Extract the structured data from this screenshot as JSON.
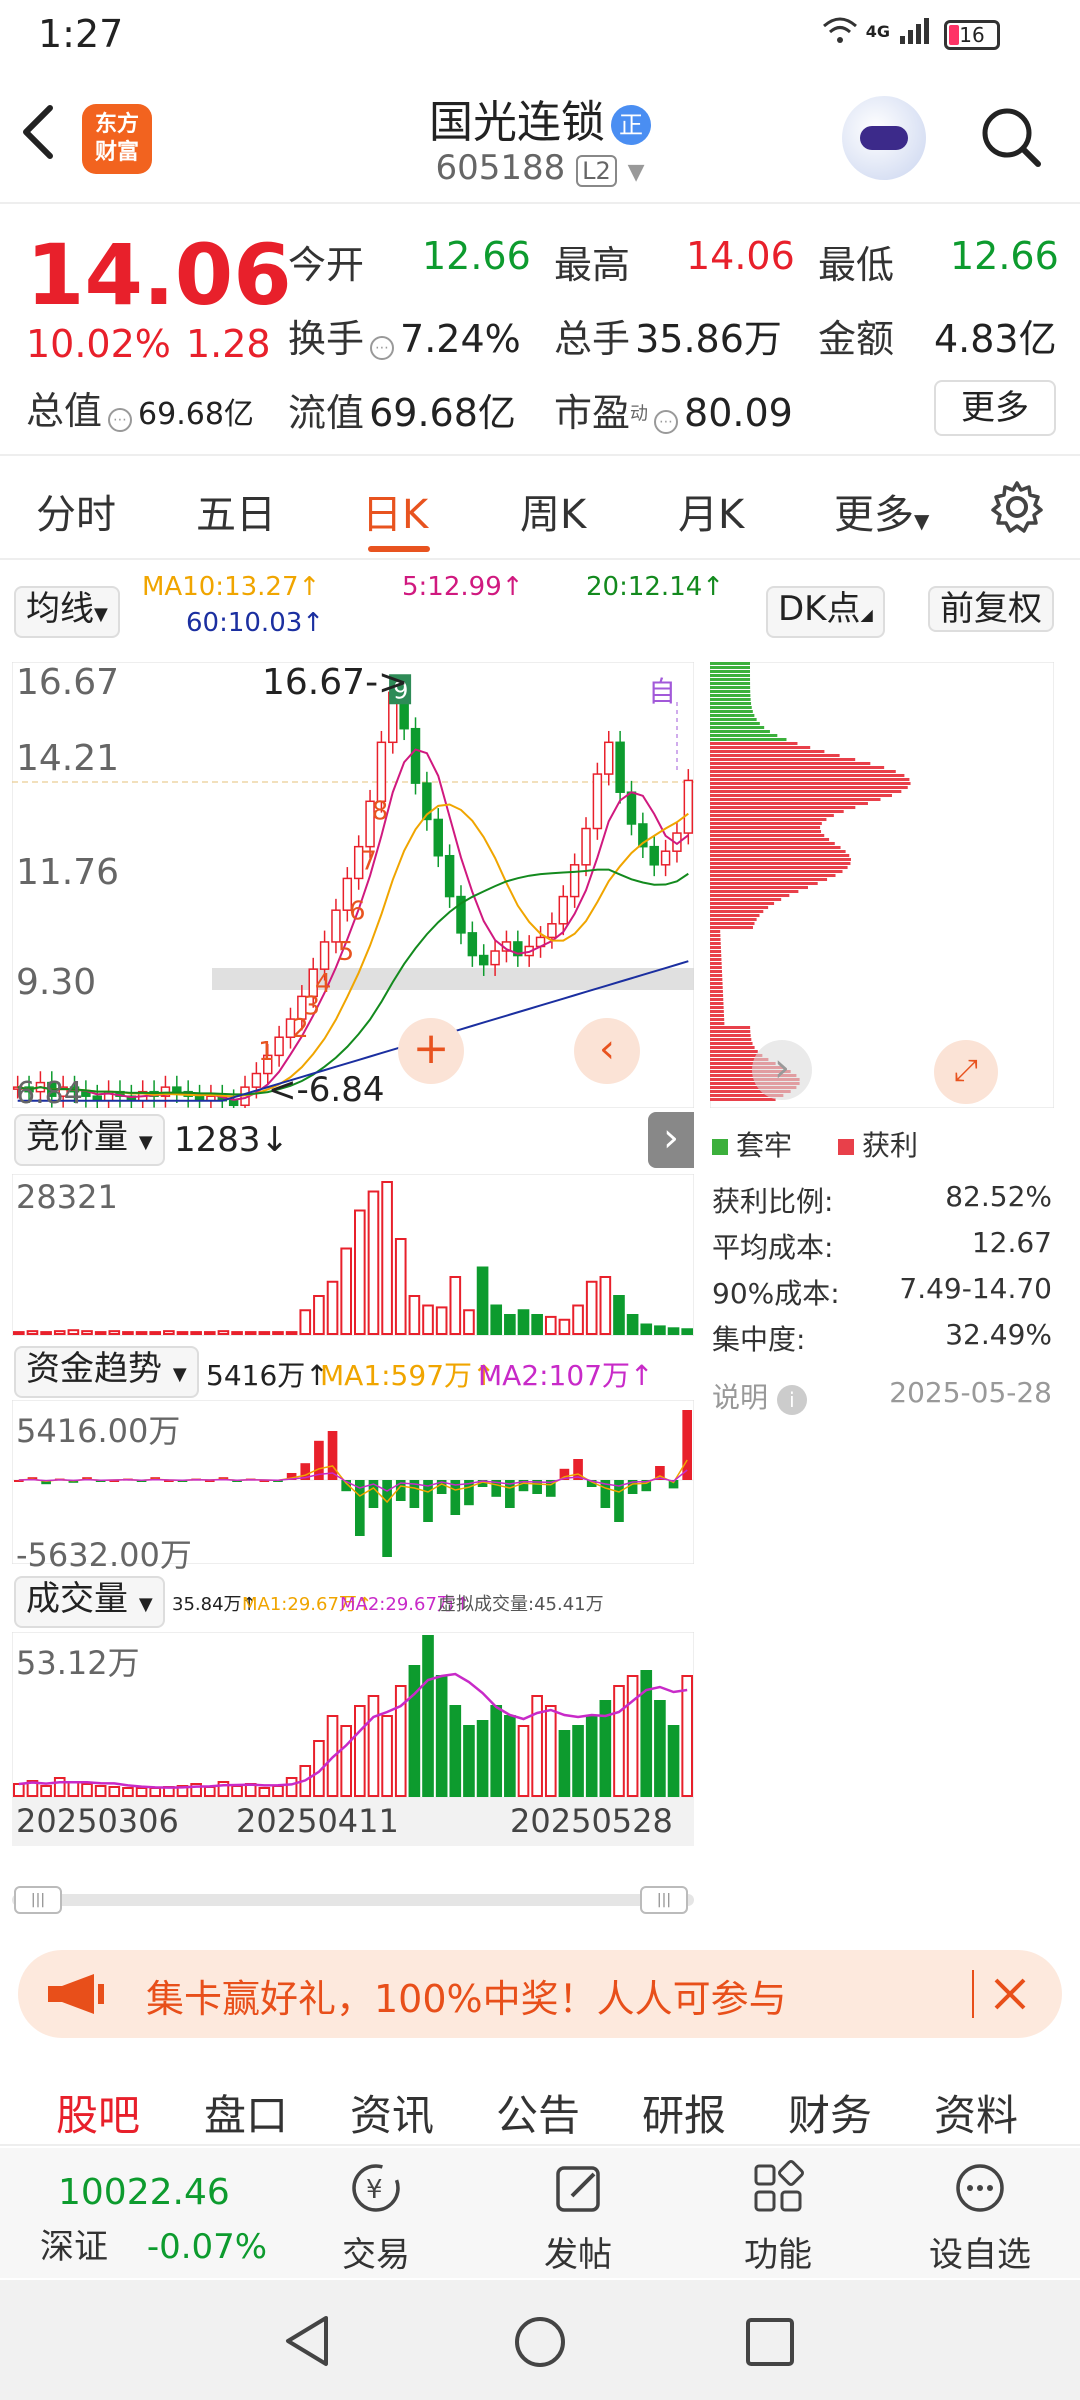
{
  "status": {
    "time": "1:27",
    "network": "4G",
    "battery": "16"
  },
  "header": {
    "back_icon": "back-arrow-icon",
    "logo_line1": "东方",
    "logo_line2": "财富",
    "stock_name": "国光连锁",
    "badge": "正",
    "stock_code": "605188",
    "level": "L2"
  },
  "quote": {
    "price": "14.06",
    "pct": "10.02%",
    "change": "1.28",
    "open_label": "今开",
    "open": "12.66",
    "high_label": "最高",
    "high": "14.06",
    "low_label": "最低",
    "low": "12.66",
    "turnover_label": "换手",
    "turnover": "7.24%",
    "volume_label": "总手",
    "volume": "35.86万",
    "amount_label": "金额",
    "amount": "4.83亿",
    "mktcap_label": "总值",
    "mktcap": "69.68亿",
    "float_label": "流值",
    "float": "69.68亿",
    "pe_label": "市盈",
    "pe_sup": "动",
    "pe": "80.09",
    "more": "更多"
  },
  "tabs": [
    "分时",
    "五日",
    "日K",
    "周K",
    "月K",
    "更多"
  ],
  "active_tab": "日K",
  "chart": {
    "ma_button": "均线",
    "ma10": "MA10:13.27↑",
    "ma5": "5:12.99↑",
    "ma20": "20:12.14↑",
    "ma60": "60:10.03↑",
    "dk_button": "DK点",
    "adj_button": "前复权",
    "y_labels": [
      "16.67",
      "14.21",
      "11.76",
      "9.30",
      "6.84"
    ],
    "high_marker": "16.67",
    "low_marker": "6.84",
    "self_tag": "自",
    "signal_numbers": [
      "1",
      "2",
      "3",
      "4",
      "5",
      "6",
      "7",
      "8",
      "9"
    ],
    "colors": {
      "up": "#e8202b",
      "down": "#0d9b2e",
      "ma5": "#d0197f",
      "ma10": "#f0a500",
      "ma20": "#138a1e",
      "ma60": "#1b2fa0"
    }
  },
  "auction": {
    "label": "竞价量",
    "value": "1283↓",
    "axis_max": "28321"
  },
  "fund_flow": {
    "label": "资金趋势",
    "value": "5416万↑",
    "ma1": "MA1:597万↑",
    "ma2": "MA2:107万↑",
    "axis_max": "5416.00万",
    "axis_min": "-5632.00万"
  },
  "volume": {
    "label": "成交量",
    "value": "35.84万↑",
    "ma1": "MA1:29.67万↑",
    "ma2": "MA2:29.67万↑",
    "virtual": "虚拟成交量:45.41万",
    "axis_max": "53.12万"
  },
  "dates": [
    "20250306",
    "20250411",
    "20250528"
  ],
  "chip_dist": {
    "legend_trapped": "套牢",
    "legend_profit": "获利",
    "rows": [
      {
        "label": "获利比例:",
        "value": "82.52%"
      },
      {
        "label": "平均成本:",
        "value": "12.67"
      },
      {
        "label": "90%成本:",
        "value": "7.49-14.70"
      },
      {
        "label": "集中度:",
        "value": "32.49%"
      }
    ],
    "note_label": "说明",
    "date": "2025-05-28"
  },
  "promo": {
    "text": "集卡赢好礼，100%中奖！人人可参与"
  },
  "bottom_tabs": [
    "股吧",
    "盘口",
    "资讯",
    "公告",
    "研报",
    "财务",
    "资料"
  ],
  "bottom_bar": {
    "index_value": "10022.46",
    "index_name": "深证",
    "index_change": "-0.07%",
    "trade": "交易",
    "post": "发帖",
    "functions": "功能",
    "watchlist": "设自选"
  }
}
